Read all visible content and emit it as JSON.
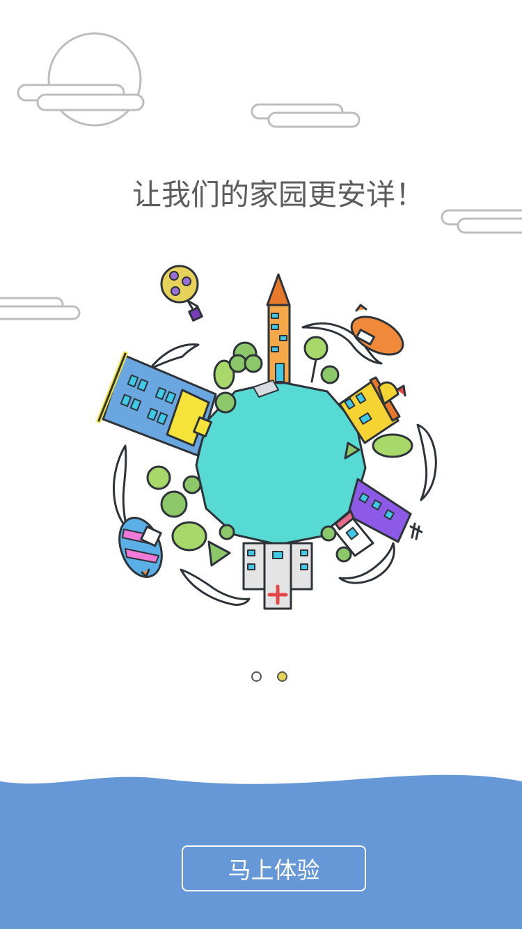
{
  "intro": {
    "headline": "让我们的家园更安详！"
  },
  "pager": {
    "page_count": 2,
    "current_page": 2
  },
  "cta": {
    "label": "马上体验"
  },
  "colors": {
    "background": "#ffffff",
    "wave_blue": "#6698d8",
    "planet_teal": "#56dad3",
    "outline": "#2d3338",
    "cloud_gray": "#bdbdbd",
    "dot_active": "#e6d15a",
    "headline_text": "#5c5c5c"
  }
}
